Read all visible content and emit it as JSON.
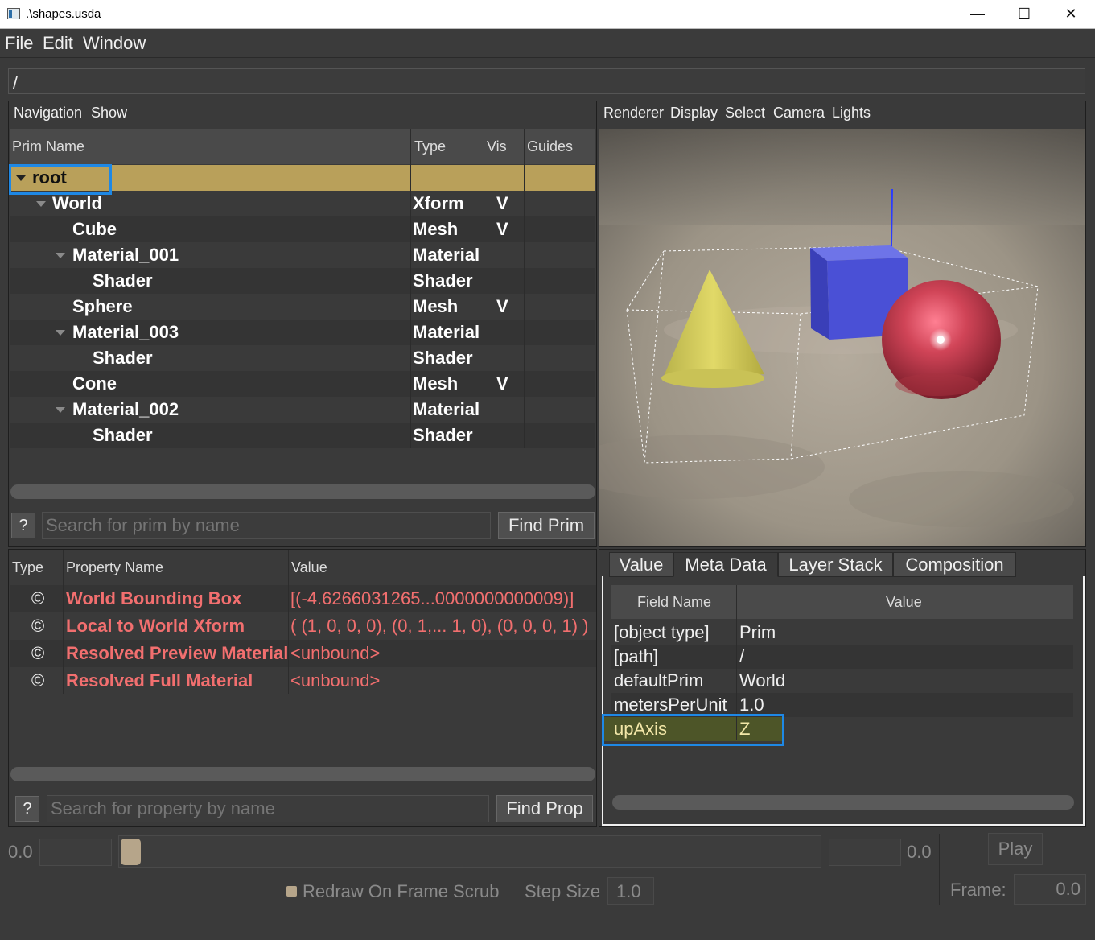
{
  "window": {
    "title": ".\\shapes.usda",
    "minimize": "—",
    "maximize": "☐",
    "close": "✕"
  },
  "menu": [
    "File",
    "Edit",
    "Window"
  ],
  "path_value": "/",
  "nav_menu": [
    "Navigation",
    "Show"
  ],
  "prim_tree": {
    "columns": [
      "Prim Name",
      "Type",
      "Vis",
      "Guides"
    ],
    "rows": [
      {
        "name": "root",
        "type": "",
        "vis": "",
        "expanded": true,
        "selected": true
      },
      {
        "name": "World",
        "type": "Xform",
        "vis": "V",
        "expanded": true
      },
      {
        "name": "Cube",
        "type": "Mesh",
        "vis": "V"
      },
      {
        "name": "Material_001",
        "type": "Material",
        "vis": "",
        "expanded": true
      },
      {
        "name": "Shader",
        "type": "Shader",
        "vis": ""
      },
      {
        "name": "Sphere",
        "type": "Mesh",
        "vis": "V"
      },
      {
        "name": "Material_003",
        "type": "Material",
        "vis": "",
        "expanded": true
      },
      {
        "name": "Shader",
        "type": "Shader",
        "vis": ""
      },
      {
        "name": "Cone",
        "type": "Mesh",
        "vis": "V"
      },
      {
        "name": "Material_002",
        "type": "Material",
        "vis": "",
        "expanded": true
      },
      {
        "name": "Shader",
        "type": "Shader",
        "vis": ""
      }
    ]
  },
  "prim_search": {
    "help": "?",
    "placeholder": "Search for prim by name",
    "button": "Find Prim"
  },
  "properties": {
    "columns": [
      "Type",
      "Property Name",
      "Value"
    ],
    "rows": [
      {
        "icon": "©",
        "name": "World Bounding Box",
        "value": "[(-4.6266031265...0000000000009)]"
      },
      {
        "icon": "©",
        "name": "Local to World Xform",
        "value": "( (1, 0, 0, 0), (0, 1,... 1, 0), (0, 0, 0, 1) )"
      },
      {
        "icon": "©",
        "name": "Resolved Preview Material",
        "value": "<unbound>"
      },
      {
        "icon": "©",
        "name": "Resolved Full Material",
        "value": "<unbound>"
      }
    ]
  },
  "prop_search": {
    "help": "?",
    "placeholder": "Search for property by name",
    "button": "Find Prop"
  },
  "viewport_menu": [
    "Renderer",
    "Display",
    "Select",
    "Camera",
    "Lights"
  ],
  "tabs": [
    {
      "label": "Value",
      "active": false
    },
    {
      "label": "Meta Data",
      "active": true
    },
    {
      "label": "Layer Stack",
      "active": false
    },
    {
      "label": "Composition",
      "active": false
    }
  ],
  "metadata": {
    "columns": [
      "Field Name",
      "Value"
    ],
    "rows": [
      {
        "field": "[object type]",
        "value": "Prim"
      },
      {
        "field": "[path]",
        "value": "/"
      },
      {
        "field": "defaultPrim",
        "value": "World"
      },
      {
        "field": "metersPerUnit",
        "value": "1.0"
      },
      {
        "field": "upAxis",
        "value": "Z",
        "selected": true
      }
    ]
  },
  "timeline": {
    "start": "0.0",
    "end": "0.0",
    "play": "Play",
    "redraw_label": "Redraw On Frame Scrub",
    "step_label": "Step Size",
    "step_value": "1.0",
    "frame_label": "Frame:",
    "frame_value": "0.0"
  },
  "colors": {
    "selection": "#b9a05a",
    "highlight_border": "#1e88e5",
    "property_text": "#f26f6f",
    "meta_selection": "#4d5528"
  }
}
